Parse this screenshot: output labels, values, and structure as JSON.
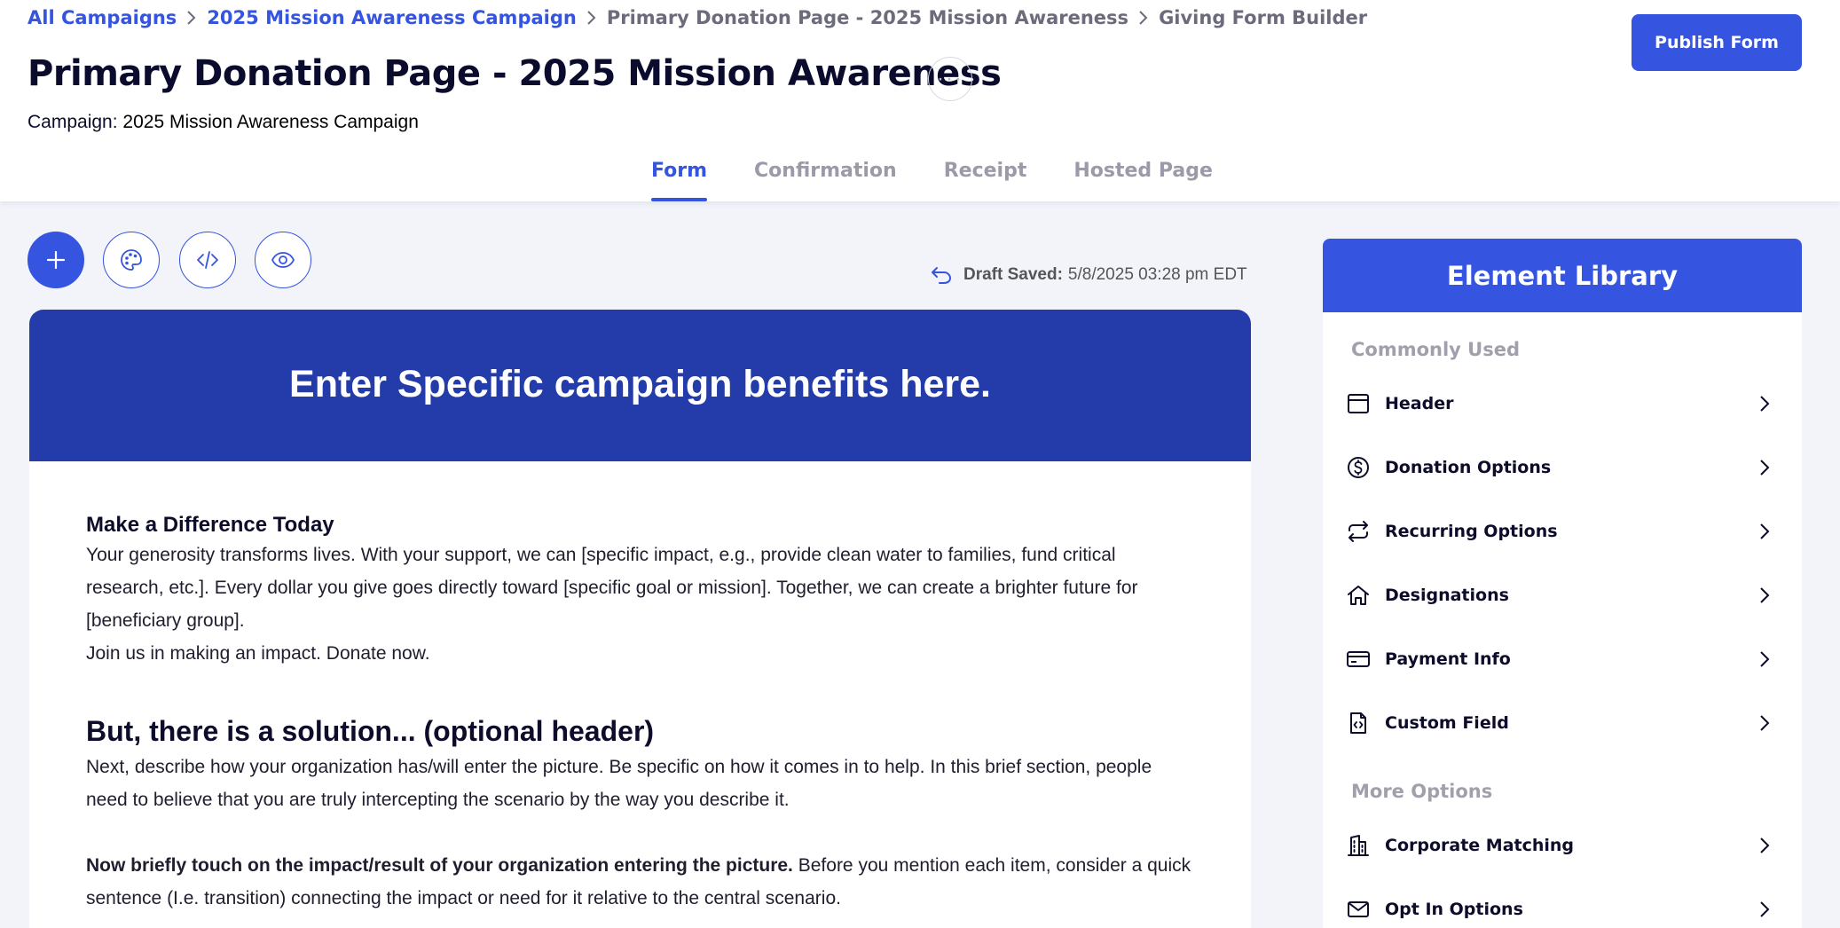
{
  "breadcrumb": {
    "items": [
      {
        "label": "All Campaigns",
        "link": true
      },
      {
        "label": "2025 Mission Awareness Campaign",
        "link": true
      },
      {
        "label": "Primary Donation Page - 2025 Mission Awareness",
        "link": false
      },
      {
        "label": "Giving Form Builder",
        "link": false
      }
    ]
  },
  "header": {
    "title": "Primary Donation Page - 2025 Mission Awareness",
    "more_label": "···",
    "campaign_prefix": "Campaign:",
    "campaign_name": "2025 Mission Awareness Campaign",
    "publish_label": "Publish Form"
  },
  "tabs": [
    {
      "label": "Form",
      "active": true
    },
    {
      "label": "Confirmation",
      "active": false
    },
    {
      "label": "Receipt",
      "active": false
    },
    {
      "label": "Hosted Page",
      "active": false
    }
  ],
  "toolbar": {
    "icons": [
      "plus-icon",
      "palette-icon",
      "code-icon",
      "eye-icon"
    ]
  },
  "draft": {
    "label": "Draft Saved:",
    "timestamp": "5/8/2025 03:28 pm EDT"
  },
  "form": {
    "hero_text": "Enter Specific campaign benefits here.",
    "section1_title": "Make a Difference Today",
    "section1_body": "Your generosity transforms lives. With your support, we can [specific impact, e.g., provide clean water to families, fund critical research, etc.]. Every dollar you give goes directly toward [specific goal or mission]. Together, we can create a brighter future for [beneficiary group].",
    "section1_cta": "Join us in making an impact. Donate now.",
    "section2_title": "But, there is a solution... (optional header)",
    "section2_body": "Next, describe how your organization has/will enter the picture. Be specific on how it comes in to help. In this brief section, people need to believe that you are truly intercepting the scenario by the way you describe it.",
    "section3_bold": "Now briefly touch on the impact/result of your organization entering the picture.",
    "section3_body": " Before you mention each item, consider a quick sentence (I.e. transition) connecting the impact or need for it relative to the central scenario."
  },
  "library": {
    "title": "Element Library",
    "common_heading": "Commonly Used",
    "common_items": [
      {
        "label": "Header",
        "icon": "header-icon"
      },
      {
        "label": "Donation Options",
        "icon": "dollar-icon"
      },
      {
        "label": "Recurring Options",
        "icon": "repeat-icon"
      },
      {
        "label": "Designations",
        "icon": "home-icon"
      },
      {
        "label": "Payment Info",
        "icon": "credit-card-icon"
      },
      {
        "label": "Custom Field",
        "icon": "code-file-icon"
      }
    ],
    "more_heading": "More Options",
    "more_items": [
      {
        "label": "Corporate Matching",
        "icon": "building-icon"
      },
      {
        "label": "Opt In Options",
        "icon": "mail-icon"
      }
    ]
  },
  "colors": {
    "accent": "#3554e0",
    "hero": "#233ca9",
    "muted": "#9a9aa8"
  }
}
